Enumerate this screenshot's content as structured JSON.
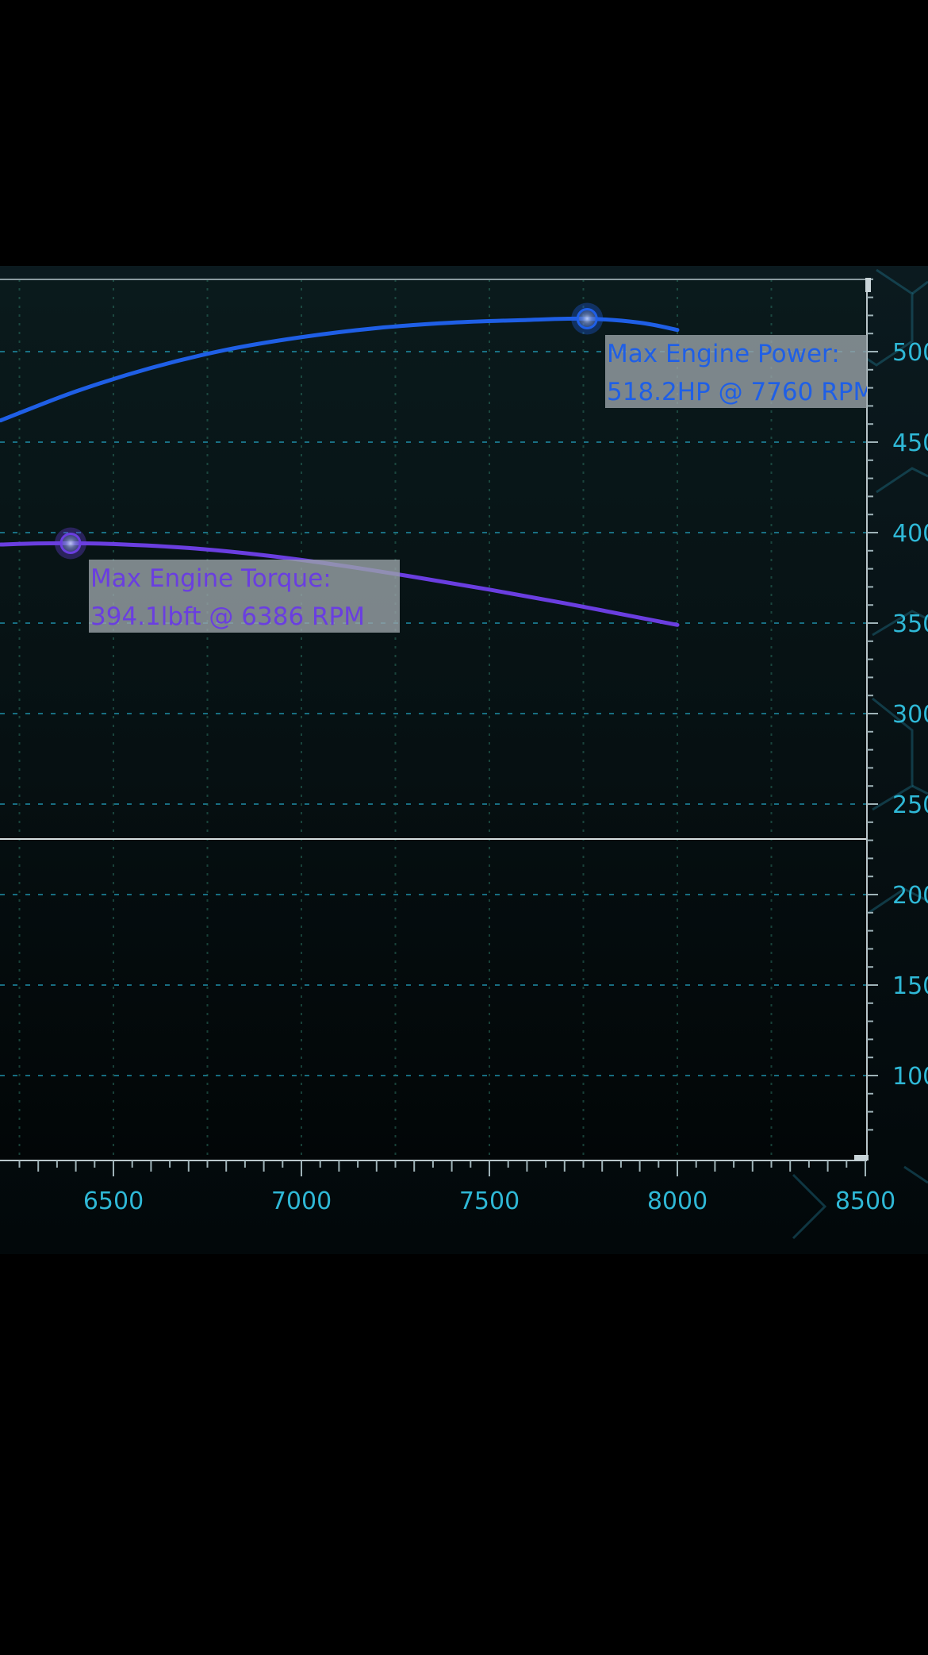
{
  "chart_data": {
    "type": "line",
    "title": "",
    "xlabel": "",
    "ylabel": "",
    "xlim": [
      6200,
      8500
    ],
    "ylim": [
      60,
      550
    ],
    "grid": true,
    "x_ticks": [
      6500,
      7000,
      7500,
      8000,
      8500
    ],
    "y_ticks": [
      100,
      150,
      200,
      250,
      300,
      350,
      400,
      450,
      500
    ],
    "y_tick_labels": [
      "100",
      "150",
      "200",
      "250",
      "300",
      "350",
      "400",
      "450",
      "500"
    ],
    "x_tick_labels": [
      "6500",
      "7000",
      "7500",
      "8000",
      "8500"
    ],
    "colors": {
      "power": "#1f5fe6",
      "torque": "#6a3ee0",
      "axis_text": "#2fb8d6",
      "grid": "#1f8fa8",
      "label_bg": "#9aa3a8"
    },
    "series": [
      {
        "key": "power",
        "x": [
          6200,
          6400,
          6600,
          6800,
          7000,
          7200,
          7400,
          7600,
          7760,
          7900,
          8000
        ],
        "values": [
          462,
          478,
          491,
          501,
          508,
          513,
          516,
          517.5,
          518.2,
          516,
          512
        ]
      },
      {
        "key": "torque",
        "x": [
          6200,
          6300,
          6386,
          6500,
          6700,
          6900,
          7100,
          7300,
          7500,
          7700,
          7900,
          8000
        ],
        "values": [
          393.4,
          394.0,
          394.1,
          393.7,
          391.5,
          387.5,
          382,
          375.5,
          368.5,
          361,
          353,
          349
        ]
      }
    ],
    "annotations": [
      {
        "series": "power",
        "x": 7760,
        "y": 518.2,
        "line1": "Max Engine Power:",
        "line2": "518.2HP @ 7760 RPM"
      },
      {
        "series": "torque",
        "x": 6386,
        "y": 394.1,
        "line1": "Max Engine Torque:",
        "line2": "394.1lbft @ 6386 RPM"
      }
    ]
  }
}
